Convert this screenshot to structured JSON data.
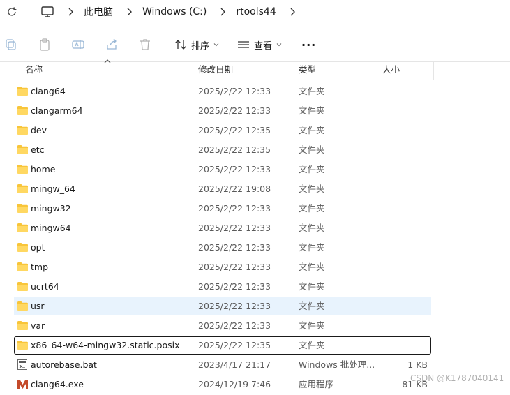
{
  "address": {
    "breadcrumbs": [
      "此电脑",
      "Windows (C:)",
      "rtools44"
    ]
  },
  "toolbar": {
    "sort_label": "排序",
    "view_label": "查看",
    "more_label": "···"
  },
  "columns": {
    "name": "名称",
    "date": "修改日期",
    "type": "类型",
    "size": "大小"
  },
  "files": [
    {
      "name": "clang64",
      "date": "2025/2/22 12:33",
      "type": "文件夹",
      "size": "",
      "icon": "folder-icon"
    },
    {
      "name": "clangarm64",
      "date": "2025/2/22 12:33",
      "type": "文件夹",
      "size": "",
      "icon": "folder-icon"
    },
    {
      "name": "dev",
      "date": "2025/2/22 12:35",
      "type": "文件夹",
      "size": "",
      "icon": "folder-icon"
    },
    {
      "name": "etc",
      "date": "2025/2/22 12:35",
      "type": "文件夹",
      "size": "",
      "icon": "folder-icon"
    },
    {
      "name": "home",
      "date": "2025/2/22 12:33",
      "type": "文件夹",
      "size": "",
      "icon": "folder-icon"
    },
    {
      "name": "mingw_64",
      "date": "2025/2/22 19:08",
      "type": "文件夹",
      "size": "",
      "icon": "folder-icon"
    },
    {
      "name": "mingw32",
      "date": "2025/2/22 12:33",
      "type": "文件夹",
      "size": "",
      "icon": "folder-icon"
    },
    {
      "name": "mingw64",
      "date": "2025/2/22 12:33",
      "type": "文件夹",
      "size": "",
      "icon": "folder-icon"
    },
    {
      "name": "opt",
      "date": "2025/2/22 12:33",
      "type": "文件夹",
      "size": "",
      "icon": "folder-icon"
    },
    {
      "name": "tmp",
      "date": "2025/2/22 12:33",
      "type": "文件夹",
      "size": "",
      "icon": "folder-icon"
    },
    {
      "name": "ucrt64",
      "date": "2025/2/22 12:33",
      "type": "文件夹",
      "size": "",
      "icon": "folder-icon"
    },
    {
      "name": "usr",
      "date": "2025/2/22 12:33",
      "type": "文件夹",
      "size": "",
      "icon": "folder-icon",
      "selected": true
    },
    {
      "name": "var",
      "date": "2025/2/22 12:33",
      "type": "文件夹",
      "size": "",
      "icon": "folder-icon"
    },
    {
      "name": "x86_64-w64-mingw32.static.posix",
      "date": "2025/2/22 12:35",
      "type": "文件夹",
      "size": "",
      "icon": "folder-icon",
      "focused": true
    },
    {
      "name": "autorebase.bat",
      "date": "2023/4/17 21:17",
      "type": "Windows 批处理...",
      "size": "1 KB",
      "icon": "batch-file-icon"
    },
    {
      "name": "clang64.exe",
      "date": "2024/12/19 7:46",
      "type": "应用程序",
      "size": "81 KB",
      "icon": "msys-app-icon"
    }
  ],
  "watermark": "CSDN @K1787040141",
  "colors": {
    "folder": "#f8c53a",
    "selected_row": "#e8f3fd",
    "accent": "#0067c0"
  }
}
